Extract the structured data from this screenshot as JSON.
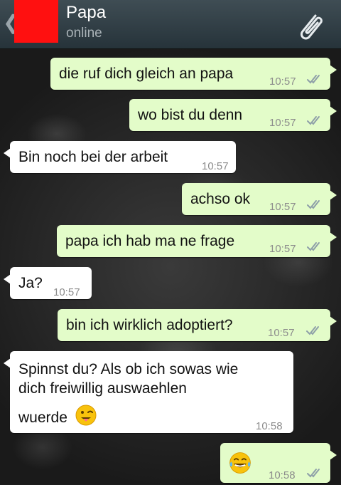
{
  "header": {
    "back_glyph": "❮",
    "contact_name": "Papa",
    "status": "online"
  },
  "messages": [
    {
      "direction": "out",
      "text": "die ruf dich gleich an papa",
      "time": "10:57"
    },
    {
      "direction": "out",
      "text": "wo bist du denn",
      "time": "10:57"
    },
    {
      "direction": "in",
      "text": "Bin noch bei der arbeit",
      "time": "10:57"
    },
    {
      "direction": "out",
      "text": "achso ok",
      "time": "10:57"
    },
    {
      "direction": "out",
      "text": "papa ich hab ma ne frage",
      "time": "10:57"
    },
    {
      "direction": "in",
      "text": "Ja?",
      "time": "10:57"
    },
    {
      "direction": "out",
      "text": "bin ich wirklich adoptiert?",
      "time": "10:57"
    },
    {
      "direction": "in",
      "lines": [
        "Spinnst du? Als ob ich sowas wie",
        "dich freiwillig auswaehlen",
        "wuerde"
      ],
      "time": "10:58",
      "emoji": "winking-tongue-emoji"
    },
    {
      "direction": "out",
      "text": "",
      "time": "10:58",
      "emoji": "tears-of-joy-emoji"
    }
  ],
  "colors": {
    "outgoing_bubble": "#e3fcc9",
    "incoming_bubble": "#ffffff",
    "header": "#2f3d44",
    "avatar": "#ff1010",
    "read_ticks": "#8e9fa8"
  }
}
